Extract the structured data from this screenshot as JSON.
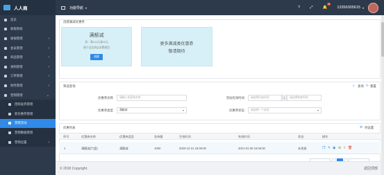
{
  "brand": {
    "title": "人人商"
  },
  "topbar": {
    "menu_label": "功能导航",
    "question": "?",
    "expand": "⤢",
    "notif_count": "9",
    "username": "13356305615"
  },
  "sidebar": {
    "items": [
      {
        "label": "首页"
      },
      {
        "label": "收银系统"
      },
      {
        "label": "收银管理"
      },
      {
        "label": "会员管理"
      },
      {
        "label": "商品管理"
      },
      {
        "label": "采购管理"
      },
      {
        "label": "订单管理"
      },
      {
        "label": "财务管理"
      },
      {
        "label": "营销管理"
      }
    ],
    "subitems": [
      {
        "label": "团购发券管理"
      },
      {
        "label": "新优惠券管理"
      },
      {
        "label": "营销活动"
      },
      {
        "label": "营销数据管理"
      },
      {
        "label": "营销设置"
      }
    ]
  },
  "create_panel": {
    "title": "创建满减优惠券",
    "card1": {
      "title": "满额减",
      "line1": "如：满100元减20元",
      "line2": "便于会员到店消费使用",
      "button": "创建"
    },
    "card2": {
      "line1": "更多满减类优惠券",
      "line2": "敬请期待"
    }
  },
  "filter_panel": {
    "title": "筛选查询",
    "search_btn": "查询",
    "reset_btn": "重置",
    "name_label": "优惠券名称",
    "name_placeholder": "请输入优惠券名称",
    "date_label": "活动有效时间",
    "start_placeholder": "请选择开始时间",
    "tilde": "至",
    "end_placeholder": "请选择结束时间",
    "type_label": "优惠券类型",
    "type_value": "满额减",
    "status_label": "优惠券状态",
    "status_placeholder": "请选择一个选项"
  },
  "table_panel": {
    "title": "优惠列表",
    "sort_label": "列设置",
    "columns": [
      "序号",
      "优惠券名称",
      "优惠券类型",
      "发券量",
      "生效时间",
      "失效时间",
      "状态",
      "操作"
    ],
    "rows": [
      [
        "1",
        "满额减(六盘)",
        "满额减",
        "1000",
        "2020-12-31 16:05:00",
        "2021-01-30 16:05:00",
        "未发放"
      ]
    ]
  },
  "footer": {
    "copyright": "© 2018 Copyright.",
    "back_top": "返回顶部"
  },
  "colors": {
    "primary": "#2f8ae8",
    "sidebar": "#2d3a4b",
    "card": "#d7f0f7"
  }
}
